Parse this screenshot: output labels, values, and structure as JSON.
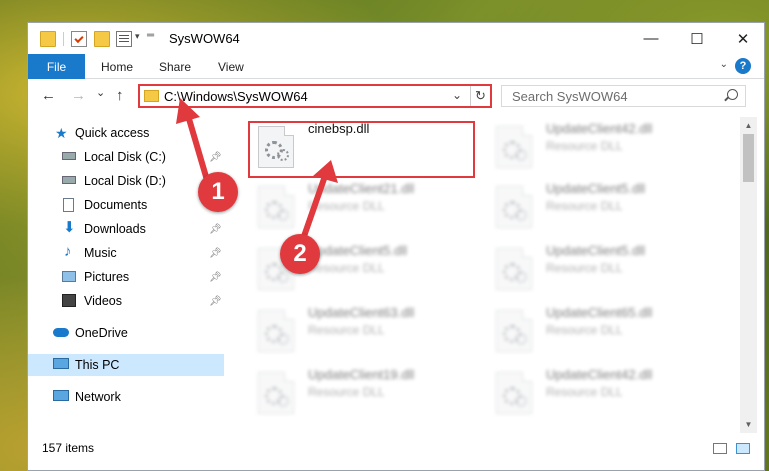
{
  "window": {
    "title": "SysWOW64",
    "minimize": "—",
    "maximize": "☐",
    "close": "✕"
  },
  "ribbon": {
    "file": "File",
    "tabs": [
      "Home",
      "Share",
      "View"
    ],
    "help": "?",
    "expand": "⌄"
  },
  "nav": {
    "back": "←",
    "forward": "→",
    "recent": "⌄",
    "up": "↑",
    "address": "C:\\Windows\\SysWOW64",
    "address_dropdown": "⌄",
    "refresh": "↻",
    "search_placeholder": "Search SysWOW64"
  },
  "sidebar": {
    "items": [
      {
        "label": "Quick access",
        "icon": "star-icon",
        "pinned": false
      },
      {
        "label": "Local Disk (C:)",
        "icon": "drive-icon",
        "pinned": true
      },
      {
        "label": "Local Disk (D:)",
        "icon": "drive-icon",
        "pinned": false
      },
      {
        "label": "Documents",
        "icon": "documents-icon",
        "pinned": true
      },
      {
        "label": "Downloads",
        "icon": "download-icon",
        "pinned": true
      },
      {
        "label": "Music",
        "icon": "music-icon",
        "pinned": true
      },
      {
        "label": "Pictures",
        "icon": "pictures-icon",
        "pinned": true
      },
      {
        "label": "Videos",
        "icon": "videos-icon",
        "pinned": true
      },
      {
        "label": "OneDrive",
        "icon": "cloud-icon",
        "pinned": false
      },
      {
        "label": "This PC",
        "icon": "computer-icon",
        "pinned": false,
        "selected": true
      },
      {
        "label": "Network",
        "icon": "network-icon",
        "pinned": false
      }
    ]
  },
  "files": {
    "left": [
      {
        "name": "cinebsp.dll",
        "type": ""
      },
      {
        "name": "UpdateClient21.dll",
        "type": "Resource DLL"
      },
      {
        "name": "UpdateClient5.dll",
        "type": "Resource DLL"
      },
      {
        "name": "UpdateClient63.dll",
        "type": "Resource DLL"
      },
      {
        "name": "UpdateClient19.dll",
        "type": "Resource DLL"
      }
    ],
    "right": [
      {
        "name": "UpdateClient42.dll",
        "type": "Resource DLL"
      },
      {
        "name": "UpdateClient5.dll",
        "type": "Resource DLL"
      },
      {
        "name": "UpdateClient5.dll",
        "type": "Resource DLL"
      },
      {
        "name": "UpdateClient65.dll",
        "type": "Resource DLL"
      },
      {
        "name": "UpdateClient42.dll",
        "type": "Resource DLL"
      }
    ]
  },
  "status": {
    "item_count": "157 items"
  },
  "annotations": {
    "marker1": "1",
    "marker2": "2",
    "color": "#e0393e"
  },
  "colors": {
    "accent": "#1979ca",
    "selection": "#cce8ff",
    "highlight": "#e0393e"
  }
}
